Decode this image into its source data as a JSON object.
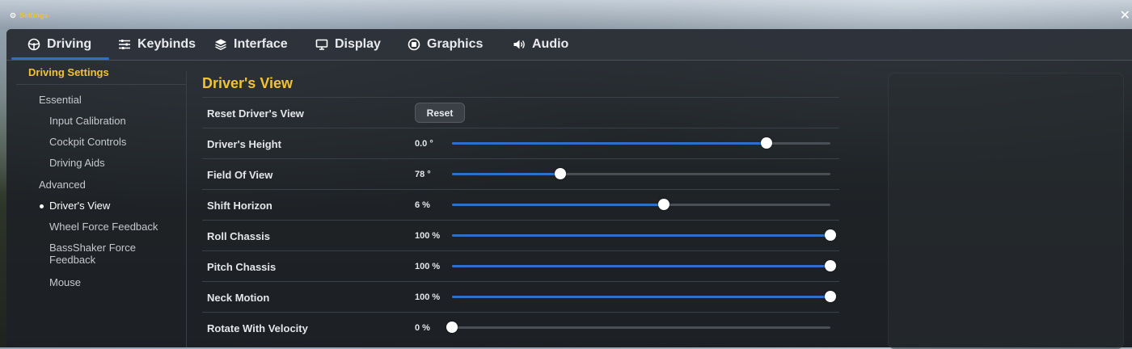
{
  "window": {
    "title": "Settings",
    "close_glyph": "✕"
  },
  "tabs": [
    {
      "label": "Driving",
      "icon": "steering-wheel-icon",
      "active": true
    },
    {
      "label": "Keybinds",
      "icon": "sliders-icon"
    },
    {
      "label": "Interface",
      "icon": "layers-icon"
    },
    {
      "label": "Display",
      "icon": "monitor-icon"
    },
    {
      "label": "Graphics",
      "icon": "chip-icon"
    },
    {
      "label": "Audio",
      "icon": "speaker-icon"
    }
  ],
  "sidebar": {
    "heading": "Driving Settings",
    "items": [
      {
        "label": "Essential"
      },
      {
        "label": "Input Calibration"
      },
      {
        "label": "Cockpit Controls"
      },
      {
        "label": "Driving Aids"
      },
      {
        "label": "Advanced"
      },
      {
        "label": "Driver's View",
        "active": true
      },
      {
        "label": "Wheel Force Feedback"
      },
      {
        "label": "BassShaker Force",
        "label2": "Feedback"
      },
      {
        "label": "Mouse"
      }
    ]
  },
  "section": {
    "title": "Driver's View",
    "reset_row": {
      "label": "Reset Driver's View",
      "button": "Reset"
    },
    "rows": [
      {
        "label": "Driver's Height",
        "value": "0.0 °",
        "fraction": 0.832
      },
      {
        "label": "Field Of View",
        "value": "78 °",
        "fraction": 0.286
      },
      {
        "label": "Shift Horizon",
        "value": "6 %",
        "fraction": 0.56
      },
      {
        "label": "Roll Chassis",
        "value": "100 %",
        "fraction": 1.0
      },
      {
        "label": "Pitch Chassis",
        "value": "100 %",
        "fraction": 1.0
      },
      {
        "label": "Neck Motion",
        "value": "100 %",
        "fraction": 1.0
      },
      {
        "label": "Rotate With Velocity",
        "value": "0 %",
        "fraction": 0.0
      }
    ]
  },
  "colors": {
    "accent": "#f2c230",
    "slider_fill": "#2f6fc7"
  }
}
